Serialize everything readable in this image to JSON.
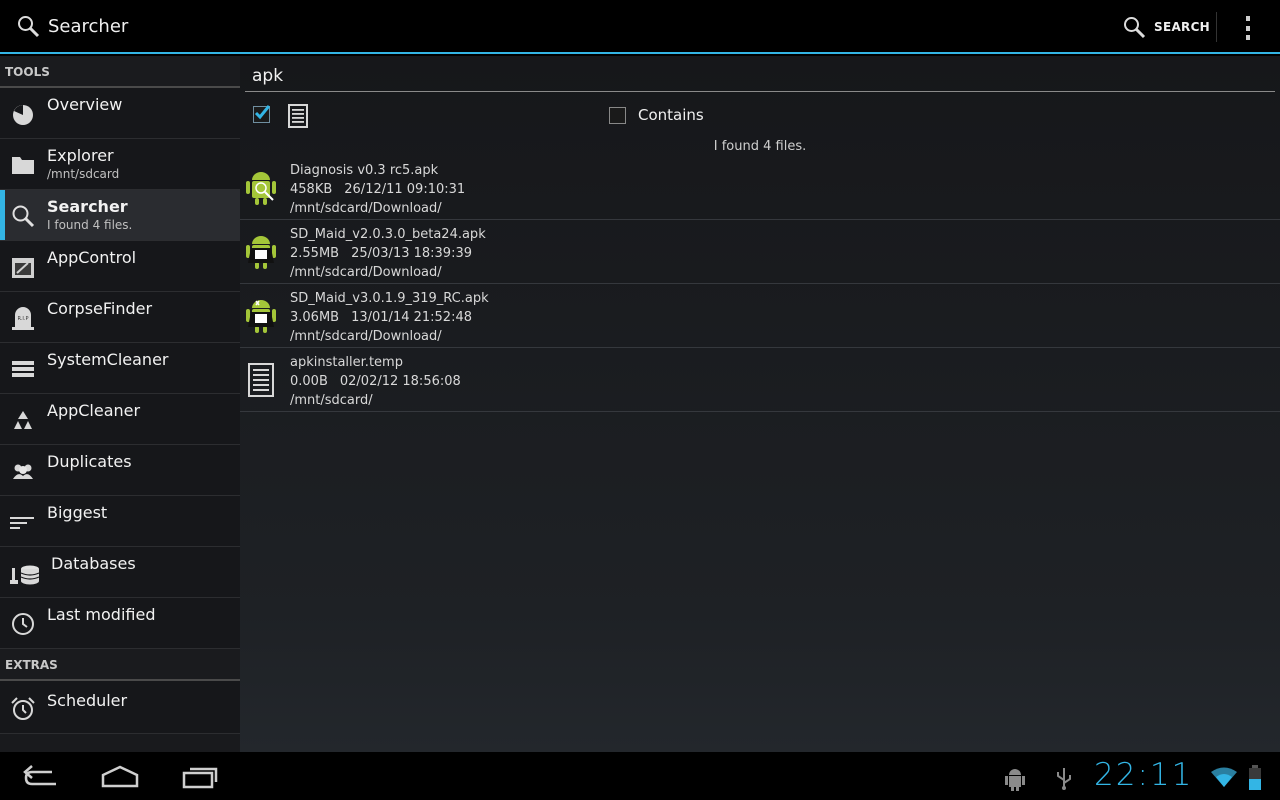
{
  "actionbar": {
    "title": "Searcher",
    "search_label": "SEARCH",
    "icons": [
      "search-icon",
      "overflow-menu-icon"
    ]
  },
  "sidebar": {
    "tools_header": "TOOLS",
    "items": [
      {
        "label": "Overview",
        "sub": "",
        "icon": "pie-chart-icon"
      },
      {
        "label": "Explorer",
        "sub": "/mnt/sdcard",
        "icon": "folder-icon"
      },
      {
        "label": "Searcher",
        "sub": "I found 4 files.",
        "icon": "search-icon"
      },
      {
        "label": "AppControl",
        "sub": "",
        "icon": "app-box-icon"
      },
      {
        "label": "CorpseFinder",
        "sub": "",
        "icon": "tombstone-icon"
      },
      {
        "label": "SystemCleaner",
        "sub": "",
        "icon": "server-icon"
      },
      {
        "label": "AppCleaner",
        "sub": "",
        "icon": "recycle-icon"
      },
      {
        "label": "Duplicates",
        "sub": "",
        "icon": "people-icon"
      },
      {
        "label": "Biggest",
        "sub": "",
        "icon": "sort-bars-icon"
      },
      {
        "label": "Databases",
        "sub": "",
        "icon": "database-icon"
      },
      {
        "label": "Last modified",
        "sub": "",
        "icon": "clock-icon"
      }
    ],
    "extras_header": "EXTRAS",
    "extras": [
      {
        "label": "Scheduler",
        "icon": "alarm-icon"
      }
    ]
  },
  "main": {
    "query": "apk",
    "contains_label": "Contains",
    "found_text": "I found 4 files.",
    "results": [
      {
        "name": "Diagnosis v0.3 rc5.apk",
        "size": "458KB",
        "date": "26/12/11 09:10:31",
        "path": "/mnt/sdcard/Download/",
        "icon": "android-diagnosis-icon"
      },
      {
        "name": "SD_Maid_v2.0.3.0_beta24.apk",
        "size": "2.55MB",
        "date": "25/03/13 18:39:39",
        "path": "/mnt/sdcard/Download/",
        "icon": "android-maid-icon"
      },
      {
        "name": "SD_Maid_v3.0.1.9_319_RC.apk",
        "size": "3.06MB",
        "date": "13/01/14 21:52:48",
        "path": "/mnt/sdcard/Download/",
        "icon": "android-maid-icon"
      },
      {
        "name": "apkinstaller.temp",
        "size": "0.00B",
        "date": "02/02/12 18:56:08",
        "path": "/mnt/sdcard/",
        "icon": "document-icon"
      }
    ]
  },
  "statusbar": {
    "clock": "22:11"
  },
  "colors": {
    "accent": "#33b5e5",
    "android_green": "#a4c639"
  }
}
